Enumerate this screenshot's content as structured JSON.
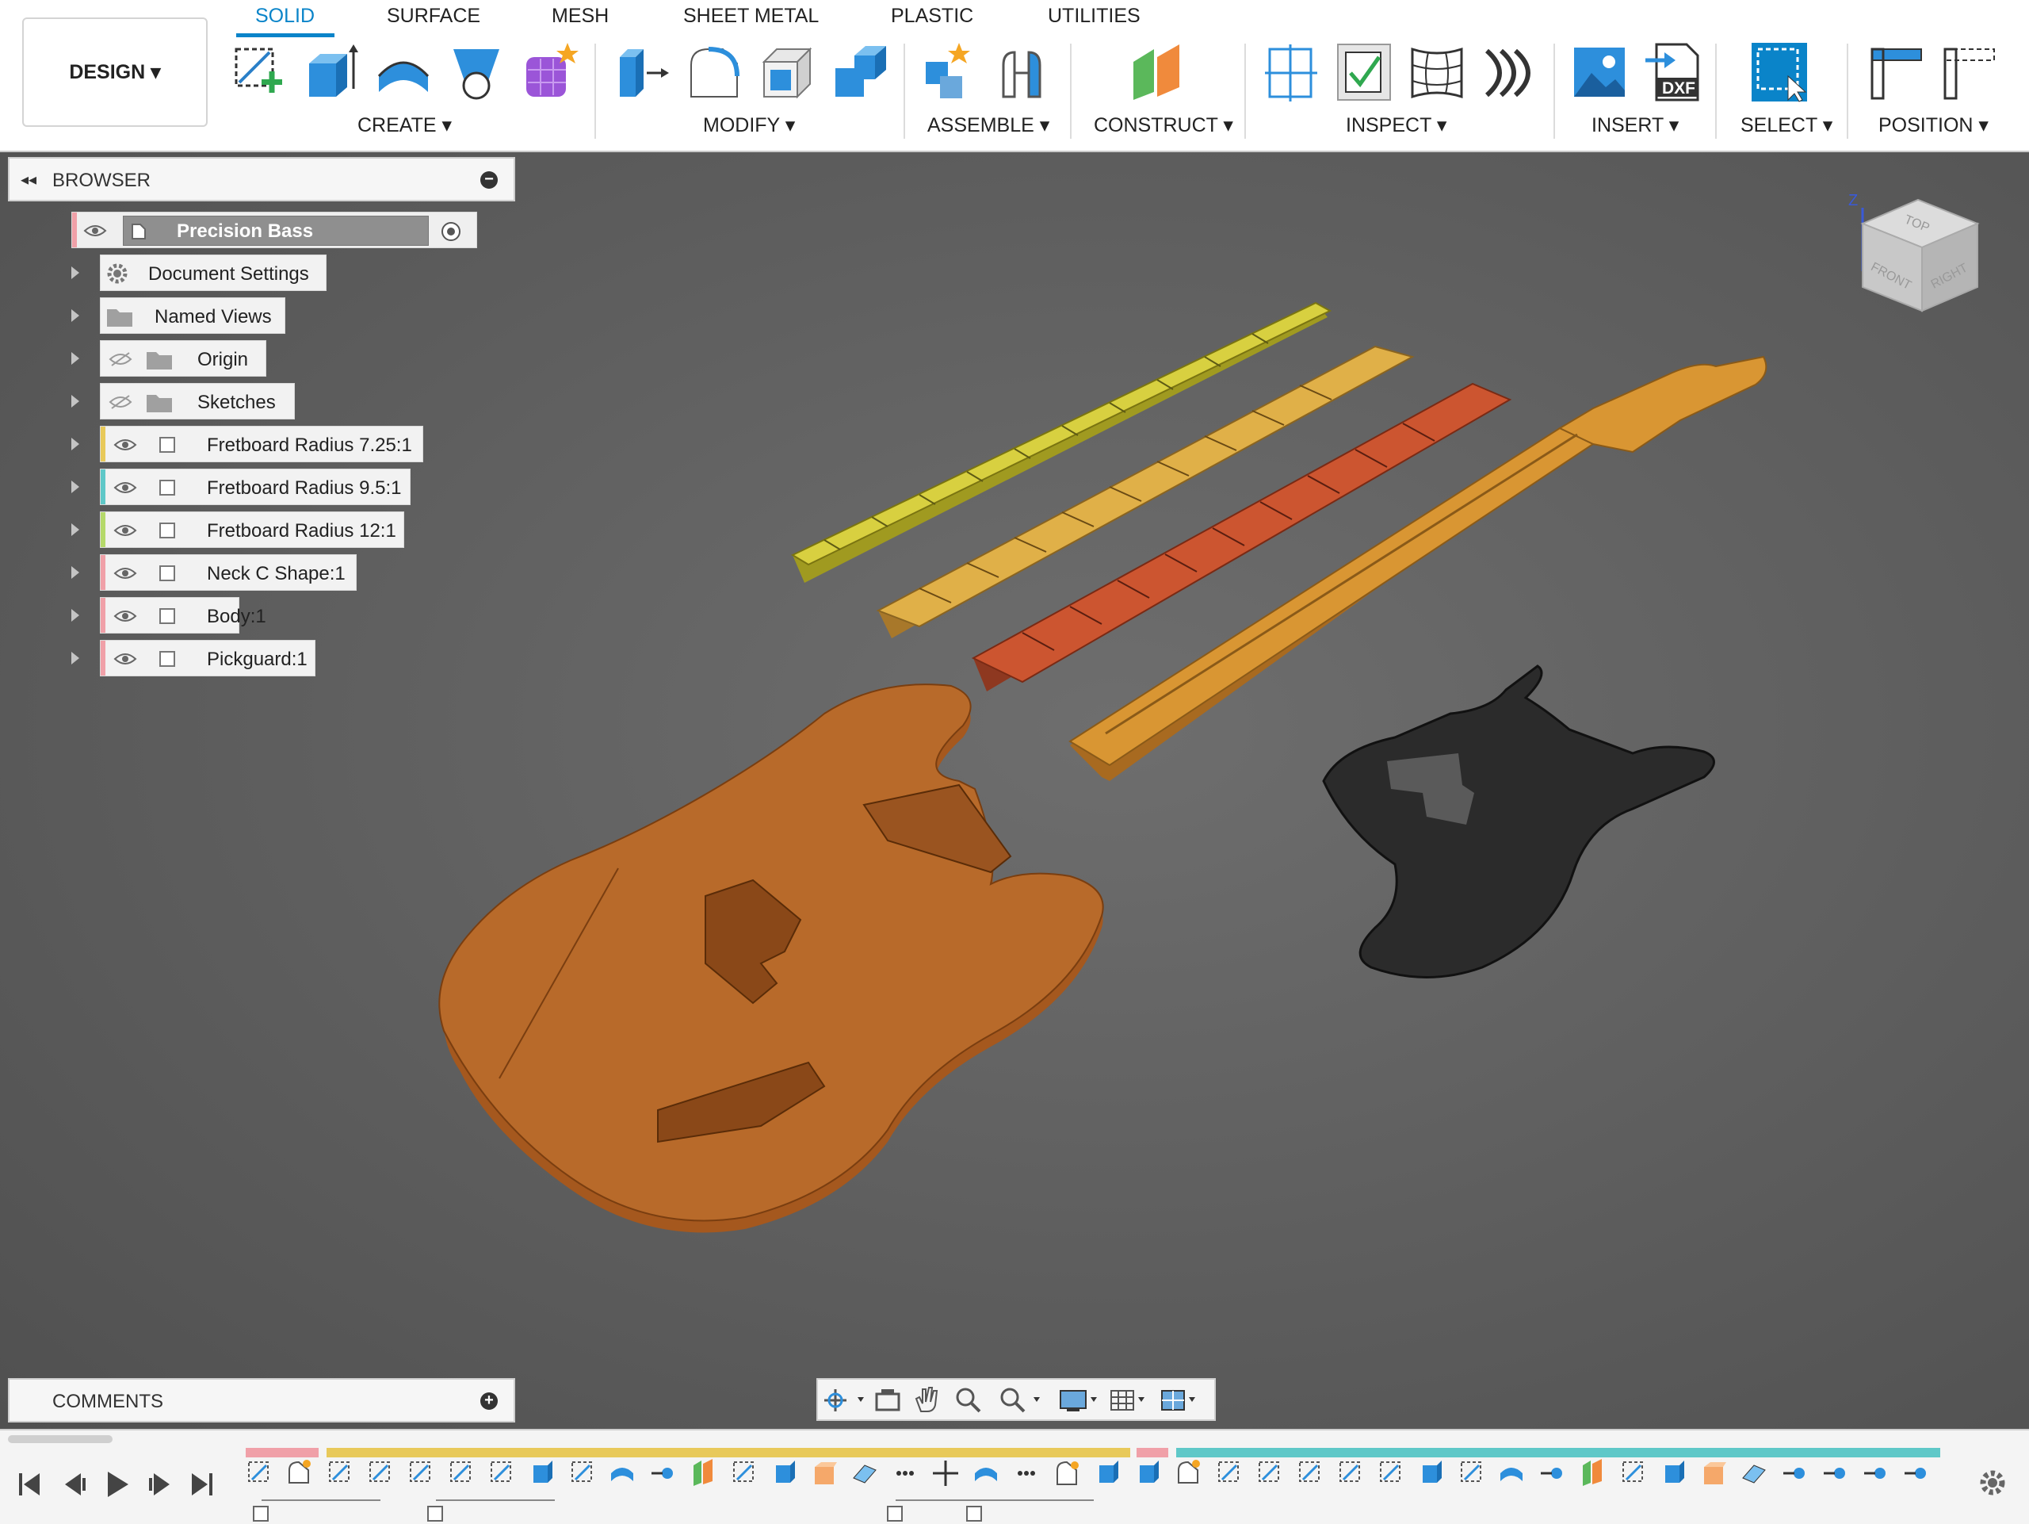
{
  "toolbar": {
    "design_label": "DESIGN ▾",
    "tabs": [
      {
        "label": "SOLID",
        "active": true
      },
      {
        "label": "SURFACE"
      },
      {
        "label": "MESH"
      },
      {
        "label": "SHEET METAL"
      },
      {
        "label": "PLASTIC"
      },
      {
        "label": "UTILITIES"
      }
    ],
    "groups": {
      "create": "CREATE ▾",
      "modify": "MODIFY ▾",
      "assemble": "ASSEMBLE ▾",
      "construct": "CONSTRUCT ▾",
      "inspect": "INSPECT ▾",
      "insert": "INSERT ▾",
      "select": "SELECT ▾",
      "position": "POSITION ▾"
    },
    "dxf_label": "DXF"
  },
  "browser": {
    "title": "BROWSER",
    "root": "Precision Bass",
    "items": [
      {
        "label": "Document Settings",
        "icon": "gear-icon"
      },
      {
        "label": "Named Views",
        "icon": "folder-icon"
      },
      {
        "label": "Origin",
        "icon": "folder-icon",
        "hidden": true
      },
      {
        "label": "Sketches",
        "icon": "folder-icon",
        "hidden": true
      },
      {
        "label": "Fretboard Radius 7.25:1",
        "color": "#e8c95a"
      },
      {
        "label": "Fretboard Radius 9.5:1",
        "color": "#5fc8c8"
      },
      {
        "label": "Fretboard Radius 12:1",
        "color": "#b5d96a"
      },
      {
        "label": "Neck C Shape:1",
        "color": "#f0a0a8"
      },
      {
        "label": "Body:1",
        "color": "#f0a0a8"
      },
      {
        "label": "Pickguard:1",
        "color": "#f0a0a8"
      }
    ]
  },
  "comments": {
    "title": "COMMENTS"
  },
  "viewcube": {
    "top": "TOP",
    "front": "FRONT",
    "right": "RIGHT",
    "z_axis": "Z"
  },
  "colors": {
    "accent": "#0a84c9",
    "body_wood": "#b86a2a",
    "neck_wood": "#d99633",
    "fretboard_yellow": "#d8d040",
    "fretboard_amber": "#e0a53c",
    "fretboard_red": "#cc5530",
    "pickguard": "#2b2b2b"
  }
}
